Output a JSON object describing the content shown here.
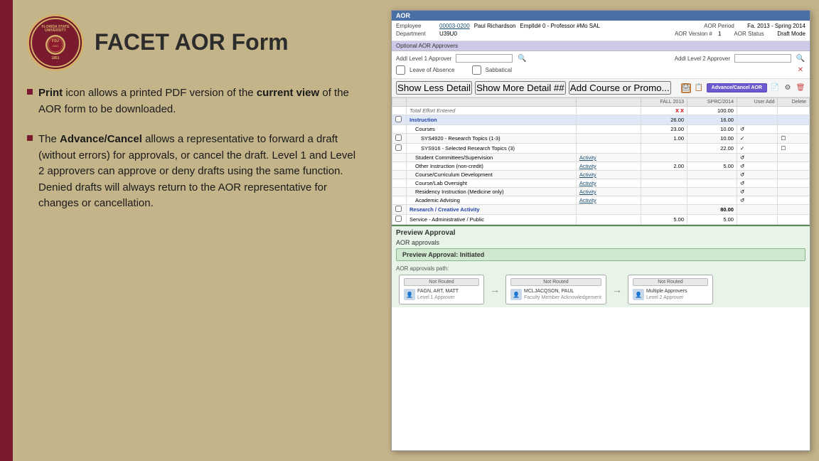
{
  "slide": {
    "title": "FACET AOR Form",
    "logo": {
      "university": "FLORIDA STATE UNIVERSITY",
      "year": "1851"
    },
    "bullets": [
      {
        "id": "bullet-print",
        "bold_start": "Print",
        "text": " icon allows a printed PDF version of the ",
        "bold_mid": "current view",
        "text_end": " of the AOR form to be downloaded."
      },
      {
        "id": "bullet-advance",
        "bold_start": "The ",
        "bold_word": "Advance/Cancel",
        "text": " allows a representative to forward a draft (without errors) for approvals, or cancel the draft. Level 1 and Level 2 approvers can approve or deny drafts using the same function. Denied drafts will always return to the AOR representative for changes or cancellation."
      }
    ]
  },
  "screenshot": {
    "aor_header": "AOR",
    "employee_label": "Employee",
    "employee_id": "00003-0200",
    "employee_name": "Paul Richardson",
    "emplid_label": "EmplId# 0 - Professor #Mo SAL",
    "aor_period_label": "AOR Period",
    "aor_period_value": "Fa. 2013 - Spring 2014",
    "department_label": "Department",
    "department_value": "U39U0",
    "aor_version_label": "AOR Version #",
    "aor_version": "1",
    "aor_status_label": "AOR Status",
    "aor_status": "Draft Mode",
    "optional_header": "Optional AOR Approvers",
    "addl_level1_label": "Addl Level 1 Approver",
    "addl_level2_label": "Addl Level 2 Approver",
    "leave_absence_label": "Leave of Absence",
    "sabbatical_label": "Sabbatical",
    "buttons": {
      "show_less": "Show Less Detail",
      "show_more": "Show More Detail ##",
      "add_course": "Add Course or Promo...",
      "advance_cancel": "Advance/Cancel AOR"
    },
    "column_headers": {
      "fall2013": "FALL 2013",
      "spr2014": "SPRC/2014",
      "user_add": "User Add",
      "delete": "Delete"
    },
    "table_rows": [
      {
        "label": "Total Effort Entered",
        "fall": "X X",
        "spring": "100.00",
        "bold": true,
        "red_fall": true
      },
      {
        "label": "Instruction",
        "fall": "26.00",
        "spring": "16.00",
        "bold": true,
        "indent": 0
      },
      {
        "label": "Courses",
        "fall": "23.00",
        "spring": "10.00",
        "indent": 1,
        "has_icon": true
      },
      {
        "label": "SYS4920 - Research Topics (1-3)",
        "fall": "1.00",
        "spring": "10.00",
        "indent": 2,
        "has_check": true
      },
      {
        "label": "SYS916 - Selected Research Topics (3)",
        "fall": "",
        "spring": "22.00",
        "indent": 2,
        "has_check": true
      },
      {
        "label": "Student Committees/Supervision",
        "fall": "",
        "spring": "",
        "indent": 1,
        "link_label": "Activity"
      },
      {
        "label": "Other Instruction (non-credit)",
        "fall": "2.00",
        "spring": "5.00",
        "indent": 1,
        "link_label": "Activity",
        "has_icon": true
      },
      {
        "label": "Course/Curriculum Development",
        "fall": "",
        "spring": "",
        "indent": 1,
        "link_label": "Activity"
      },
      {
        "label": "Course/Lab Oversight",
        "fall": "",
        "spring": "",
        "indent": 1,
        "link_label": "Activity"
      },
      {
        "label": "Residency Instruction (Medicine only)",
        "fall": "",
        "spring": "",
        "indent": 1,
        "link_label": "Activity"
      },
      {
        "label": "Academic Advising",
        "fall": "",
        "spring": "",
        "indent": 1,
        "link_label": "Activity"
      },
      {
        "label": "Research / Creative Activity",
        "fall": "",
        "spring": "80.00",
        "bold": true,
        "blue": true
      },
      {
        "label": "Service - Administrative / Public",
        "fall": "5.00",
        "spring": "5.00",
        "bold": false
      }
    ],
    "preview_section": {
      "title": "Preview Approval",
      "aor_approvals_label": "AOR approvals",
      "status_label": "Preview Approval:",
      "status_value": "Initiated",
      "path_label": "AOR approvals path:",
      "approval_boxes": [
        {
          "badge": "Not Routed",
          "badge_type": "not-routed",
          "person_name": "FAGN, ART, MATT",
          "role": "Level 1 Approver"
        },
        {
          "badge": "Not Routed",
          "badge_type": "not-routed",
          "person_name": "MCLJACQSON, PAUL",
          "role": "Faculty Member Acknowledgement"
        },
        {
          "badge": "Not Routed",
          "badge_type": "not-routed",
          "person_name": "Multiple Approvers",
          "role": "Level 2 Approver"
        }
      ]
    }
  }
}
